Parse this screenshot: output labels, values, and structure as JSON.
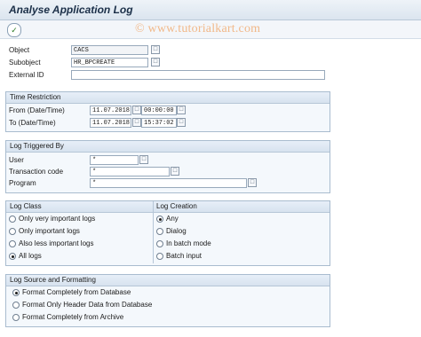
{
  "window": {
    "title": "Analyse Application Log"
  },
  "toolbar": {
    "execute_icon": "execute-icon"
  },
  "watermark": "© www.tutorialkart.com",
  "selection": {
    "object": {
      "label": "Object",
      "value": "CACS"
    },
    "subobject": {
      "label": "Subobject",
      "value": "HR_BPCREATE"
    },
    "external_id": {
      "label": "External ID",
      "value": ""
    }
  },
  "time_restriction": {
    "title": "Time Restriction",
    "from": {
      "label": "From (Date/Time)",
      "date": "11.07.2018",
      "time": "00:00:00"
    },
    "to": {
      "label": "To (Date/Time)",
      "date": "11.07.2018",
      "time": "15:37:02"
    }
  },
  "log_triggered_by": {
    "title": "Log Triggered By",
    "user": {
      "label": "User",
      "value": "*"
    },
    "transaction_code": {
      "label": "Transaction code",
      "value": "*"
    },
    "program": {
      "label": "Program",
      "value": "*"
    }
  },
  "log_class": {
    "title": "Log Class",
    "options": [
      {
        "label": "Only very important logs",
        "selected": false
      },
      {
        "label": "Only important logs",
        "selected": false
      },
      {
        "label": "Also less important logs",
        "selected": false
      },
      {
        "label": "All logs",
        "selected": true
      }
    ]
  },
  "log_creation": {
    "title": "Log Creation",
    "options": [
      {
        "label": "Any",
        "selected": true
      },
      {
        "label": "Dialog",
        "selected": false
      },
      {
        "label": "In batch mode",
        "selected": false
      },
      {
        "label": "Batch input",
        "selected": false
      }
    ]
  },
  "log_source": {
    "title": "Log Source and Formatting",
    "options": [
      {
        "label": "Format Completely from Database",
        "selected": true
      },
      {
        "label": "Format Only Header Data from Database",
        "selected": false
      },
      {
        "label": "Format Completely from Archive",
        "selected": false
      }
    ]
  }
}
